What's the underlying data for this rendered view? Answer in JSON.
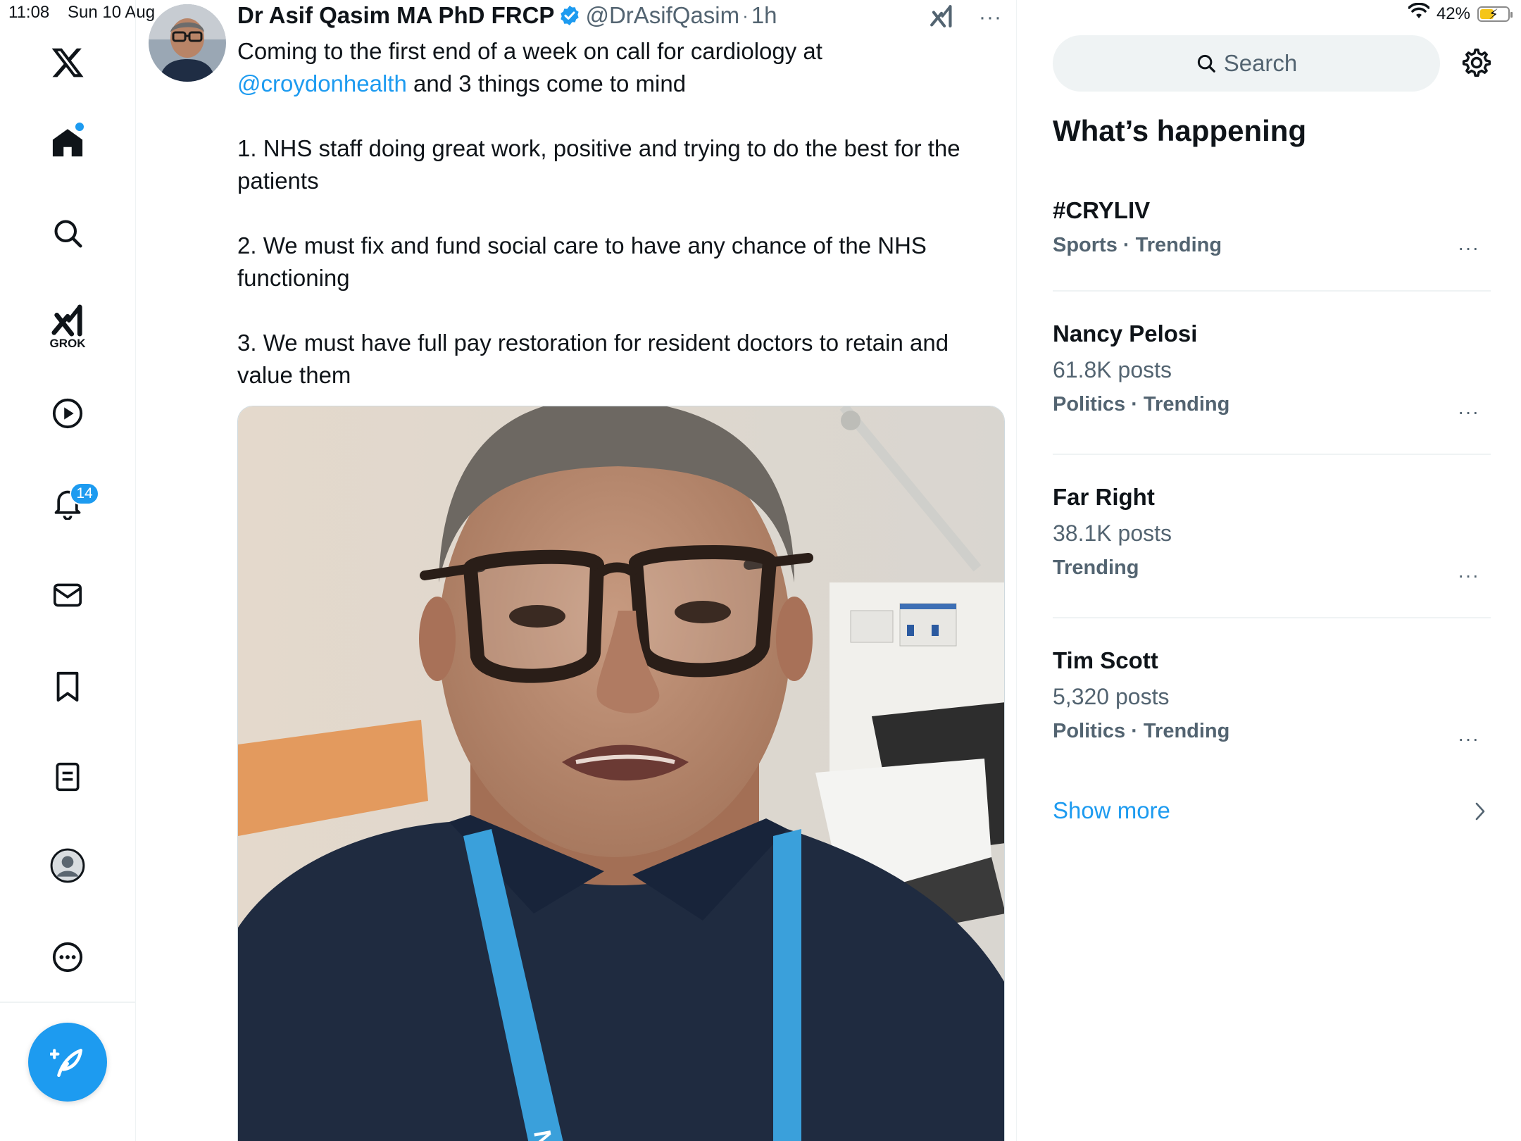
{
  "status_bar": {
    "time": "11:08",
    "date": "Sun 10 Aug",
    "battery": "42%",
    "battery_level": 0.42
  },
  "nav": {
    "grok_label": "GROK",
    "notifications_count": "14"
  },
  "post": {
    "author": "Dr Asif Qasim MA PhD FRCP",
    "handle": "@DrAsifQasim",
    "separator": "·",
    "time": "1h",
    "line1": "Coming to the first end of a week on call for cardiology at",
    "mention": "@croydonhealth",
    "line1_rest": " and 3 things come to mind",
    "point1": "1. NHS staff doing great work, positive and trying to do the best for the patients",
    "point2": "2. We must fix and fund social care to have any chance of the NHS functioning",
    "point3": "3. We must have full pay restoration for resident doctors to retain and value them",
    "lanyard_text": "NHS"
  },
  "sidebar": {
    "search_placeholder": "Search",
    "title": "What’s happening",
    "trends": [
      {
        "name": "#CRYLIV",
        "meta": "Sports · Trending"
      },
      {
        "name": "Nancy Pelosi",
        "count": "61.8K posts",
        "meta": "Politics · Trending"
      },
      {
        "name": "Far Right",
        "count": "38.1K posts",
        "meta": "Trending"
      },
      {
        "name": "Tim Scott",
        "count": "5,320 posts",
        "meta": "Politics · Trending"
      }
    ],
    "show_more": "Show more"
  },
  "colors": {
    "accent": "#1d9bf0",
    "text_primary": "#0f1419",
    "text_secondary": "#536471",
    "divider": "#eff3f4"
  }
}
